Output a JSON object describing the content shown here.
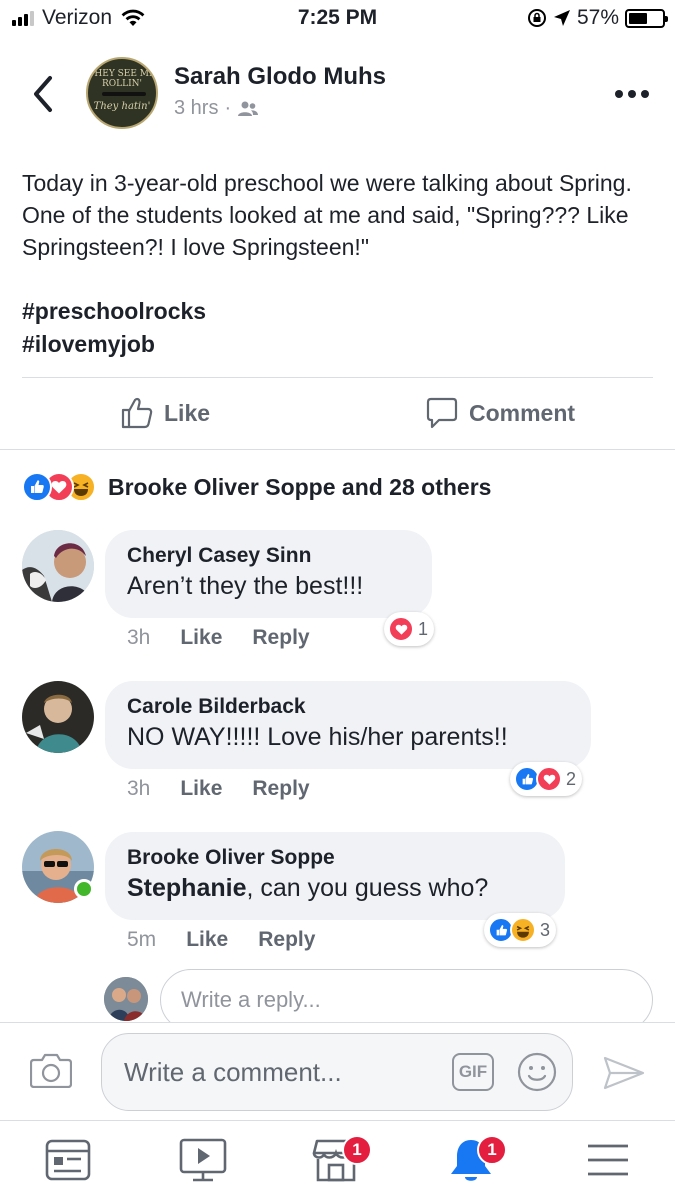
{
  "status_bar": {
    "carrier": "Verizon",
    "time": "7:25 PM",
    "battery": "57%",
    "battery_level": 0.57
  },
  "header": {
    "poster_name": "Sarah Glodo Muhs",
    "time_ago": "3 hrs",
    "separator": "·",
    "avatar_text_top": "THEY SEE ME ROLLIN'",
    "avatar_text_bottom": "They hatin'"
  },
  "post": {
    "text": "Today in 3-year-old preschool we were talking about Spring. One of the students looked at me and said, \"Spring??? Like Springsteen?! I love Springsteen!\"",
    "hashtags": [
      "#preschoolrocks",
      "#ilovemyjob"
    ]
  },
  "actions": {
    "like_label": "Like",
    "comment_label": "Comment"
  },
  "reactions_summary": {
    "text": "Brooke Oliver Soppe and 28 others",
    "types": [
      "like",
      "love",
      "haha"
    ]
  },
  "comments": [
    {
      "name": "Cheryl Casey Sinn",
      "text": "Aren’t they the best!!!",
      "time": "3h",
      "like": "Like",
      "reply": "Reply",
      "reaction_count": "1",
      "reaction_types": [
        "love"
      ]
    },
    {
      "name": "Carole Bilderback",
      "text": "NO WAY!!!!! Love his/her parents!!",
      "time": "3h",
      "like": "Like",
      "reply": "Reply",
      "reaction_count": "2",
      "reaction_types": [
        "like",
        "love"
      ]
    },
    {
      "name": "Brooke Oliver Soppe",
      "mention": "Stephanie",
      "text_rest": ", can you guess who?",
      "time": "5m",
      "like": "Like",
      "reply": "Reply",
      "reaction_count": "3",
      "reaction_types": [
        "like",
        "haha"
      ],
      "online": true
    }
  ],
  "reply_box": {
    "placeholder": "Write a reply..."
  },
  "composer": {
    "placeholder": "Write a comment...",
    "gif_label": "GIF"
  },
  "tab_bar": {
    "items": [
      "news-feed-icon",
      "watch-icon",
      "marketplace-icon",
      "notifications-icon",
      "menu-icon"
    ],
    "marketplace_badge": "1",
    "notifications_badge": "1"
  },
  "colors": {
    "facebook_blue": "#1877f2",
    "love_red": "#f33e58",
    "haha_yellow": "#f7b125",
    "badge_red": "#e41e3f",
    "online_green": "#42b72a"
  }
}
